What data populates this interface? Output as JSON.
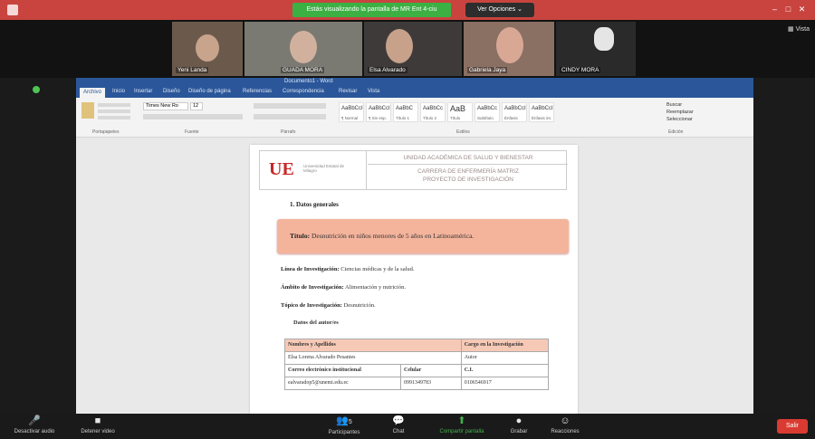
{
  "topbar": {
    "share_banner": "Estás visualizando la pantalla de MR Ent 4-ciu",
    "options_label": "Ver Opciones ⌄",
    "window_controls": [
      "–",
      "□",
      "✕"
    ],
    "colors": {
      "bar": "#c9443f",
      "banner": "#3cb043"
    }
  },
  "participants": [
    {
      "name": "Yeni Landa",
      "bg": "#6b5a4c"
    },
    {
      "name": "GUADA MORA",
      "bg": "#7a7a72"
    },
    {
      "name": "Elsa Alvarado",
      "bg": "#3e3a3a"
    },
    {
      "name": "Gabriela Jaya",
      "bg": "#8a6f63"
    },
    {
      "name": "CINDY MORA",
      "bg": "#2a2a2a"
    }
  ],
  "view_label": "Vista",
  "word": {
    "doc_title": "Documento1 - Word",
    "tabs": [
      "Archivo",
      "Inicio",
      "Insertar",
      "Diseño",
      "Diseño de página",
      "Referencias",
      "Correspondencia",
      "Revisar",
      "Vista"
    ],
    "font_name": "Times New Ro",
    "font_size": "12",
    "groups": [
      "Portapapeles",
      "Fuente",
      "Párrafo",
      "Estilos",
      "Edición"
    ],
    "styles": [
      {
        "sample": "AaBbCcI",
        "name": "¶ Normal"
      },
      {
        "sample": "AaBbCcI",
        "name": "¶ Sin esp."
      },
      {
        "sample": "AaBbC",
        "name": "Título 1"
      },
      {
        "sample": "AaBbCc",
        "name": "Título 2"
      },
      {
        "sample": "AaB",
        "name": "Título"
      },
      {
        "sample": "AaBbCc",
        "name": "Subtítulo"
      },
      {
        "sample": "AaBbCcI",
        "name": "Énfasis"
      },
      {
        "sample": "AaBbCcI",
        "name": "Énfasis int."
      }
    ],
    "editing": [
      "Buscar",
      "Reemplazar",
      "Seleccionar"
    ]
  },
  "document": {
    "logo_letters": "UE",
    "logo_caption": "Universidad Estatal de Milagro",
    "header_line1": "UNIDAD ACADÉMICA DE SALUD Y BIENESTAR",
    "header_line2": "CARRERA DE ENFERMERÍA MATRIZ",
    "header_line3": "PROYECTO DE INVESTIGACIÓN",
    "section": "1.   Datos generales",
    "title_label": "Título:",
    "title_value": "Desnutrición en niños menores de 5 años en Latinoamérica.",
    "lines": [
      {
        "label": "Línea de Investigación:",
        "value": "Ciencias médicas y de la salud."
      },
      {
        "label": "Ámbito de Investigación:",
        "value": "Alimentación y nutrición."
      },
      {
        "label": "Tópico de Investigación:",
        "value": "Desnutrición."
      }
    ],
    "authors_heading": "Datos del autor/es",
    "table": {
      "head": [
        "Nombres y Apellidos",
        "Cargo en la Investigación"
      ],
      "row1": [
        "Elsa Lorena Alvarado Pesantes",
        "Autor"
      ],
      "row2": [
        "Correo electrónico institucional",
        "Celular",
        "C.I."
      ],
      "row3": [
        "ealvaradop5@unemi.edu.ec",
        "0991349783",
        "0106546917"
      ]
    }
  },
  "toolbar": {
    "items": [
      {
        "icon": "🎤",
        "label": "Desactivar audio"
      },
      {
        "icon": "■",
        "label": "Detener video"
      },
      {
        "icon": "👥",
        "label": "Participantes",
        "count": "5"
      },
      {
        "icon": "💬",
        "label": "Chat"
      },
      {
        "icon": "⬆",
        "label": "Compartir pantalla"
      },
      {
        "icon": "●",
        "label": "Grabar"
      },
      {
        "icon": "☺",
        "label": "Reacciones"
      }
    ],
    "leave_label": "Salir"
  }
}
